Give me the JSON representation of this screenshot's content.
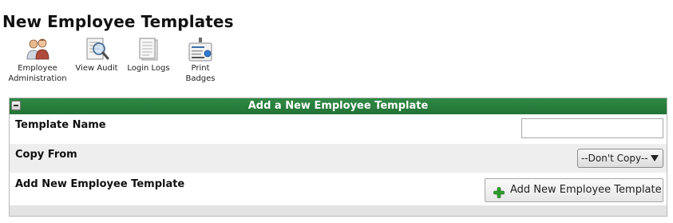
{
  "page": {
    "title": "New Employee Templates"
  },
  "toolbar": {
    "items": [
      {
        "label_line1": "Employee",
        "label_line2": "Administration",
        "icon": "people-icon"
      },
      {
        "label_line1": "View Audit",
        "label_line2": "",
        "icon": "magnifier-document-icon"
      },
      {
        "label_line1": "Login Logs",
        "label_line2": "",
        "icon": "document-log-icon"
      },
      {
        "label_line1": "Print",
        "label_line2": "Badges",
        "icon": "badge-printer-icon"
      }
    ]
  },
  "panel": {
    "title": "Add a New Employee Template",
    "header_color": "#2a7f3e",
    "rows": {
      "template_name": {
        "label": "Template Name",
        "value": ""
      },
      "copy_from": {
        "label": "Copy From",
        "selected": "--Don't Copy--"
      },
      "add_new": {
        "label": "Add New Employee Template",
        "button_label": "Add New Employee Template",
        "button_icon": "plus-icon",
        "icon_color": "#2e9e2e"
      }
    }
  }
}
